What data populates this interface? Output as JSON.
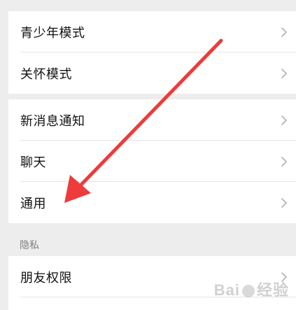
{
  "groups": [
    {
      "items": [
        {
          "label": "青少年模式"
        },
        {
          "label": "关怀模式"
        }
      ]
    },
    {
      "items": [
        {
          "label": "新消息通知"
        },
        {
          "label": "聊天"
        },
        {
          "label": "通用"
        }
      ]
    },
    {
      "section_title": "隐私",
      "items": [
        {
          "label": "朋友权限"
        }
      ]
    }
  ],
  "annotation": {
    "arrow_color": "#ee3b3b",
    "target": "通用"
  },
  "watermark": {
    "text_left": "Bai",
    "text_right": "经验"
  },
  "colors": {
    "background": "#ededed",
    "card": "#ffffff",
    "chevron": "#b2b2b2",
    "text": "#111111",
    "section_text": "#7f7f7f"
  }
}
